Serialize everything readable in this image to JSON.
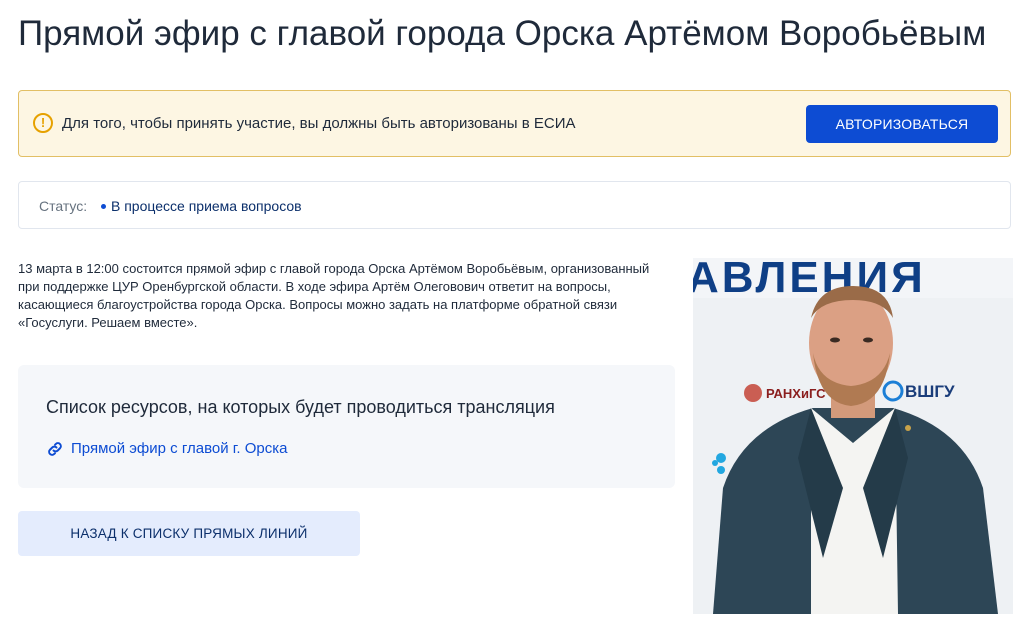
{
  "page": {
    "title": "Прямой эфир с главой города Орска Артёмом Воробьёвым"
  },
  "alert": {
    "icon": "warning-icon",
    "text": "Для того, чтобы принять участие, вы должны быть авторизованы в ЕСИА",
    "button_label": "АВТОРИЗОВАТЬСЯ"
  },
  "status": {
    "label": "Статус:",
    "value": "В процессе приема вопросов"
  },
  "description": "13 марта в 12:00 состоится прямой эфир с главой города Орска Артёмом Воробьёвым, организованный при поддержке ЦУР Оренбургской области. В ходе эфира Артём Олеговович ответит на вопросы, касающиеся благоустройства города Орска. Вопросы можно задать на платформе обратной связи «Госуслуги. Решаем вместе».",
  "resources": {
    "title": "Список ресурсов, на которых будет проводиться трансляция",
    "links": [
      {
        "icon": "link-icon",
        "label": "Прямой эфир с главой г. Орска"
      }
    ]
  },
  "back_button": "НАЗАД К СПИСКУ ПРЯМЫХ ЛИНИЙ",
  "photo": {
    "banner_text": "АВЛЕНИЯ",
    "logo_left": "РАНХиГС",
    "logo_right": "ВШГУ"
  },
  "colors": {
    "primary": "#0d4cd3",
    "alert_bg": "#fdf6e3",
    "alert_border": "#e2bf65",
    "panel_bg": "#f5f7fa"
  }
}
